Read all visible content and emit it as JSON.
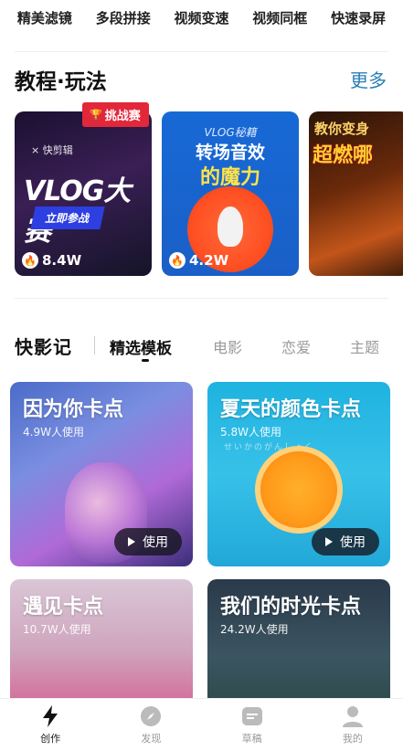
{
  "features": [
    "精美滤镜",
    "多段拼接",
    "视频变速",
    "视频同框",
    "快速录屏"
  ],
  "tutorial": {
    "title": "教程·玩法",
    "more": "更多",
    "badge": "挑战赛",
    "cards": [
      {
        "logo_text": "× 快剪辑",
        "title": "VLOG大赛",
        "button": "立即参战",
        "views": "8.4W"
      },
      {
        "subtitle": "VLOG秘籍",
        "title_line1": "转场音效",
        "title_line2": "的魔力",
        "views": "4.2W"
      },
      {
        "text_line1": "教你变身",
        "text_line2": "超燃哪"
      }
    ]
  },
  "templates": {
    "logo": "快影记",
    "tabs": [
      "精选模板",
      "电影",
      "恋爱",
      "主题"
    ],
    "active_tab": "精选模板",
    "use_label": "使用",
    "items": [
      {
        "title": "因为你卡点",
        "usage": "4.9W人使用"
      },
      {
        "title": "夏天的颜色卡点",
        "usage": "5.8W人使用",
        "caption": "せいかのがんしょく"
      },
      {
        "title": "遇见卡点",
        "usage": "10.7W人使用"
      },
      {
        "title": "我们的时光卡点",
        "usage": "24.2W人使用"
      }
    ]
  },
  "tabbar": [
    "创作",
    "发现",
    "草稿",
    "我的"
  ],
  "colors": {
    "accent_blue": "#2a7fb8",
    "badge_red": "#e3273a"
  }
}
